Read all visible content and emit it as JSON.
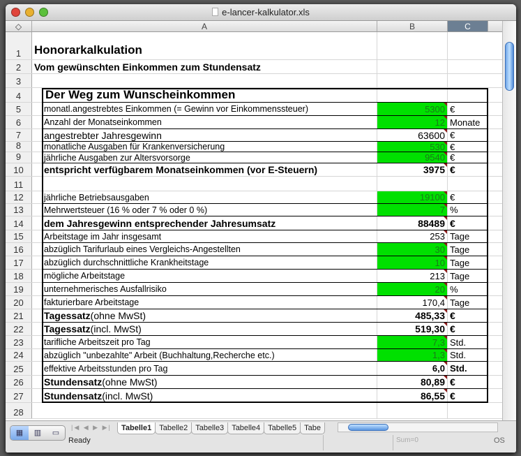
{
  "window": {
    "title": "e-lancer-kalkulator.xls"
  },
  "columns": [
    "A",
    "B",
    "C"
  ],
  "rows": [
    {
      "n": "1",
      "a": "Honorarkalkulation",
      "style": "title"
    },
    {
      "n": "2",
      "a": "Vom gewünschten Einkommen zum Stundensatz",
      "style": "subtitle"
    },
    {
      "n": "3",
      "a": ""
    },
    {
      "n": "4",
      "a": "Der Weg zum Wunscheinkommen",
      "style": "section"
    },
    {
      "n": "5",
      "a": "monatl.angestrebtes Einkommen (= Gewinn vor Einkommenssteuer)",
      "b": "5300",
      "c": "€",
      "green": true
    },
    {
      "n": "6",
      "a": "Anzahl der Monatseinkommen",
      "b": "12",
      "c": "Monate",
      "green": true
    },
    {
      "n": "7",
      "a": "angestrebter Jahresgewinn",
      "b": "63600",
      "c": "€",
      "style": "large"
    },
    {
      "n": "8",
      "a": "monatliche Ausgaben für Krankenversicherung",
      "b": "530",
      "c": "€",
      "green": true
    },
    {
      "n": "9",
      "a": "jährliche Ausgaben zur Altersvorsorge",
      "b": "9540",
      "c": "€",
      "green": true
    },
    {
      "n": "10",
      "a": "entspricht verfügbarem Monatseinkommen (vor E-Steuern)",
      "b": "3975",
      "c": "€",
      "style": "bold"
    },
    {
      "n": "11",
      "a": ""
    },
    {
      "n": "12",
      "a": "jährliche Betriebsausgaben",
      "b": "19100",
      "c": "€",
      "green": true
    },
    {
      "n": "13",
      "a": "Mehrwertsteuer (16 % oder 7 % oder 0 %)",
      "b": "7",
      "c": "%",
      "green": true
    },
    {
      "n": "14",
      "a": "dem Jahresgewinn entsprechender Jahresumsatz",
      "b": "88489",
      "c": "€",
      "style": "bold"
    },
    {
      "n": "15",
      "a": "Arbeitstage im Jahr insgesamt",
      "b": "253",
      "c": "Tage"
    },
    {
      "n": "16",
      "a": "abzüglich Tarifurlaub eines Vergleichs-Angestellten",
      "b": "30",
      "c": "Tage",
      "green": true
    },
    {
      "n": "17",
      "a": "abzüglich durchschnittliche Krankheitstage",
      "b": "10",
      "c": "Tage",
      "green": true
    },
    {
      "n": "18",
      "a": "mögliche Arbeitstage",
      "b": "213",
      "c": "Tage"
    },
    {
      "n": "19",
      "a": "unternehmerisches Ausfallrisiko",
      "b": "20",
      "c": "%",
      "green": true
    },
    {
      "n": "20",
      "a": "fakturierbare Arbeitstage",
      "b": "170,4",
      "c": "Tage"
    },
    {
      "n": "21",
      "a": "Tagessatz",
      "a2": " (ohne MwSt)",
      "b": "485,33",
      "c": "€",
      "style": "mixed"
    },
    {
      "n": "22",
      "a": "Tagessatz",
      "a2": " (incl. MwSt)",
      "b": "519,30",
      "c": "€",
      "style": "mixed"
    },
    {
      "n": "23",
      "a": "tarifliche Arbeitszeit pro Tag",
      "b": "7,3",
      "c": "Std.",
      "green": true
    },
    {
      "n": "24",
      "a": "abzüglich \"unbezahlte\" Arbeit (Buchhaltung,Recherche etc.)",
      "b": "1,3",
      "c": "Std.",
      "green": true
    },
    {
      "n": "25",
      "a": "effektive Arbeitsstunden pro Tag",
      "b": "6,0",
      "c": "Std.",
      "style": "boldval"
    },
    {
      "n": "26",
      "a": "Stundensatz",
      "a2": " (ohne MwSt)",
      "b": "80,89",
      "c": "€",
      "style": "mixed"
    },
    {
      "n": "27",
      "a": "Stundensatz",
      "a2": " (incl. MwSt)",
      "b": "86,55",
      "c": "€",
      "style": "mixed"
    },
    {
      "n": "28",
      "a": ""
    }
  ],
  "sheet_tabs": [
    "Tabelle1",
    "Tabelle2",
    "Tabelle3",
    "Tabelle4",
    "Tabelle5",
    "Tabe"
  ],
  "status": {
    "ready": "Ready",
    "sum": "Sum=0",
    "mode": "OS"
  },
  "colors": {
    "input_green": "#00e000"
  }
}
